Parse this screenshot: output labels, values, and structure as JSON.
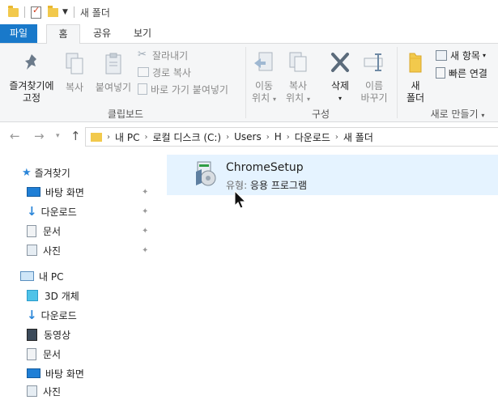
{
  "title_bar": {
    "title": "새 폴더",
    "separator": "|"
  },
  "tabs": {
    "file": "파일",
    "home": "홈",
    "share": "공유",
    "view": "보기"
  },
  "ribbon": {
    "clipboard": {
      "pin_line1": "즐겨찾기에",
      "pin_line2": "고정",
      "copy": "복사",
      "paste": "붙여넣기",
      "cut": "잘라내기",
      "copy_path": "경로 복사",
      "paste_shortcut": "바로 가기 붙여넣기",
      "label": "클립보드"
    },
    "organize": {
      "move_line1": "이동",
      "move_line2": "위치",
      "copyto_line1": "복사",
      "copyto_line2": "위치",
      "delete": "삭제",
      "rename_line1": "이름",
      "rename_line2": "바꾸기",
      "label": "구성"
    },
    "new": {
      "new_folder_line1": "새",
      "new_folder_line2": "폴더",
      "new_item": "새 항목",
      "easy_access": "빠른 연결",
      "label": "새로 만들기"
    }
  },
  "address": {
    "crumbs": [
      "내 PC",
      "로컬 디스크 (C:)",
      "Users",
      "H",
      "다운로드",
      "새 폴더"
    ]
  },
  "nav": {
    "quick_access": "즐겨찾기",
    "qa_items": [
      "바탕 화면",
      "다운로드",
      "문서",
      "사진"
    ],
    "this_pc": "내 PC",
    "pc_items": [
      "3D 개체",
      "다운로드",
      "동영상",
      "문서",
      "바탕 화면",
      "사진"
    ]
  },
  "content": {
    "file_name": "ChromeSetup",
    "type_label": "유형:",
    "type_value": "응용 프로그램"
  },
  "colors": {
    "accent": "#1979ca",
    "selection": "#e5f3ff",
    "folder": "#f2c94c"
  }
}
